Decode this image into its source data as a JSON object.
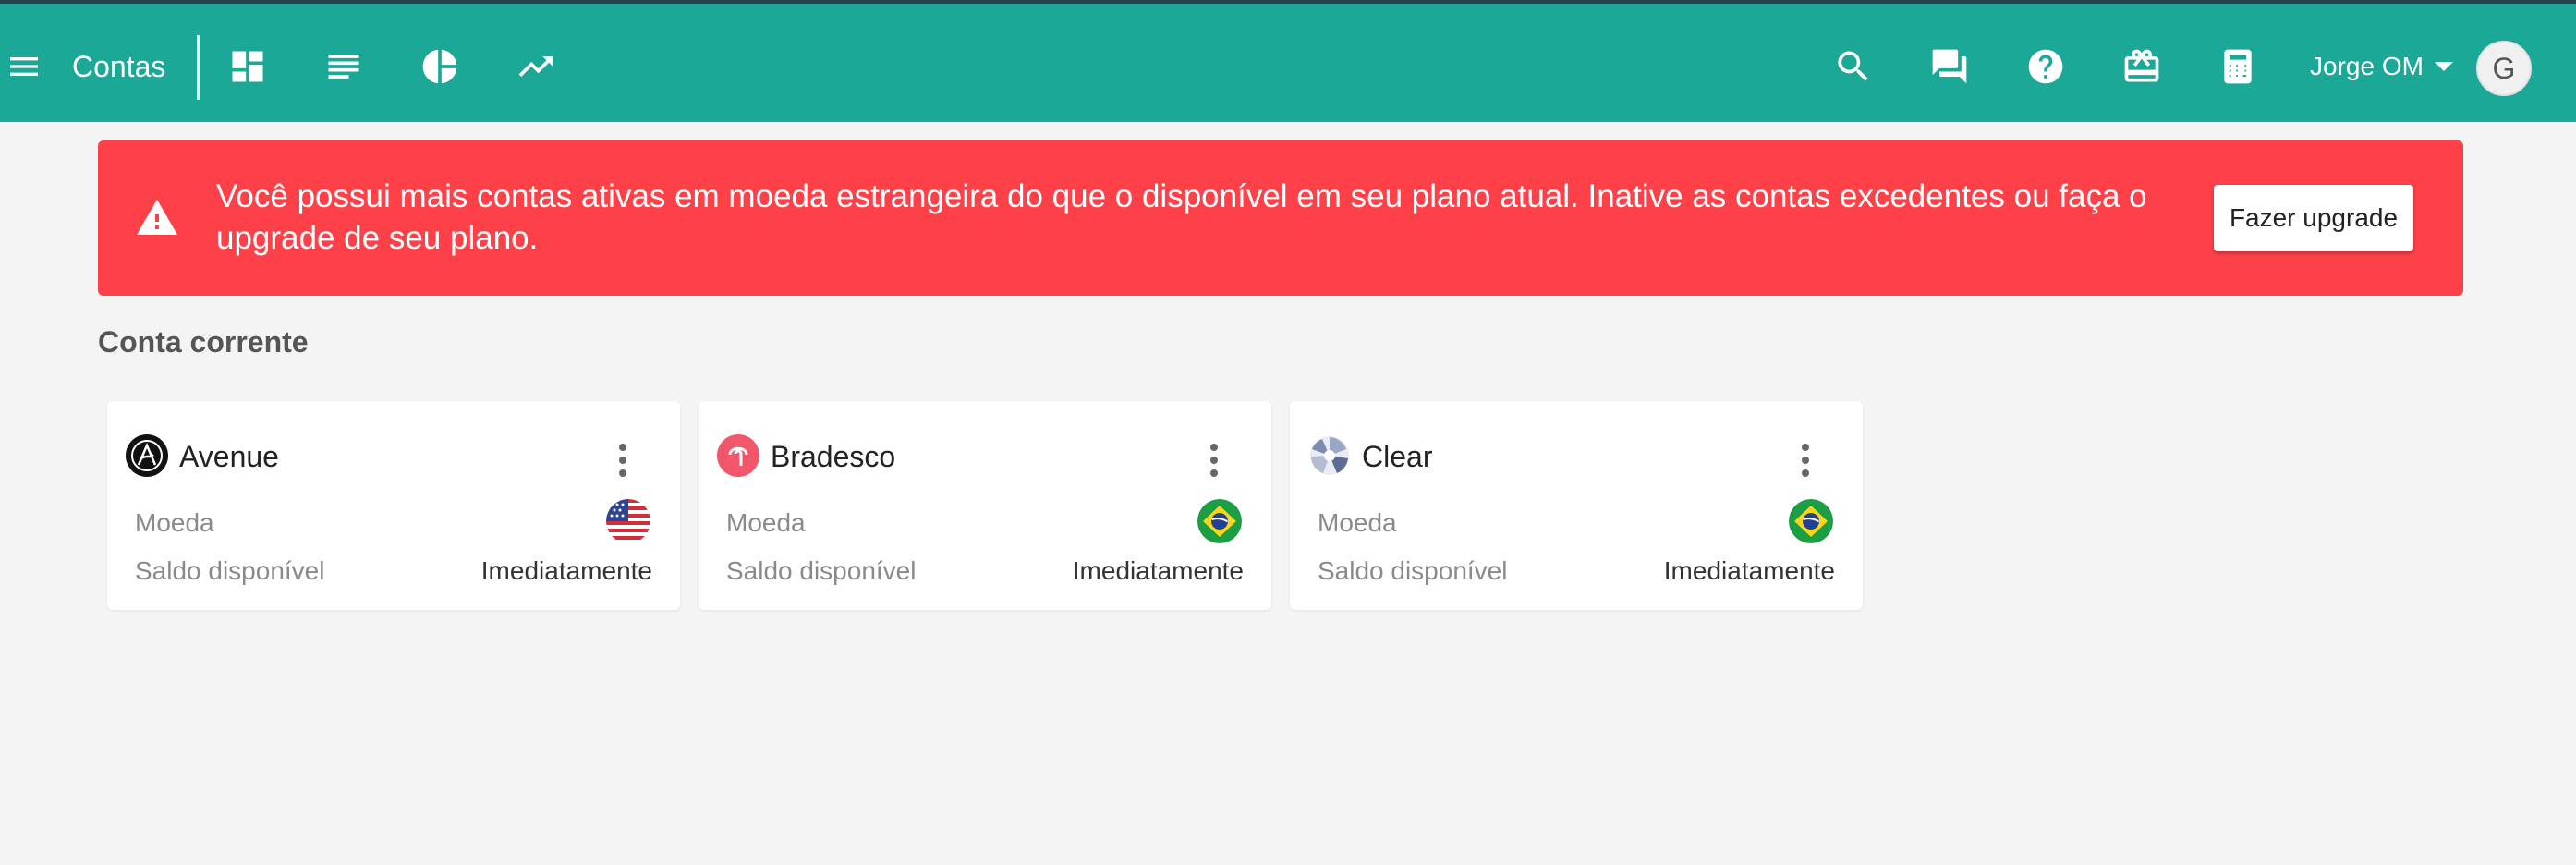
{
  "header": {
    "title": "Contas",
    "nav_icons": [
      "menu-icon",
      "dashboard-icon",
      "list-icon",
      "pie-chart-icon",
      "trending-up-icon"
    ],
    "action_icons": [
      "search-icon",
      "chat-icon",
      "help-icon",
      "gift-icon",
      "calculator-icon"
    ],
    "user": {
      "name": "Jorge OM",
      "avatar_initial": "G"
    }
  },
  "alert": {
    "message": "Você possui mais contas ativas em moeda estrangeira do que o disponível em seu plano atual. Inative as contas excedentes ou faça o upgrade de seu plano.",
    "button_label": "Fazer upgrade",
    "icon": "warning-icon"
  },
  "section": {
    "title": "Conta corrente",
    "accounts": [
      {
        "name": "Avenue",
        "logo": "avenue-logo",
        "currency_label": "Moeda",
        "currency_flag": "us-flag-icon",
        "balance_label": "Saldo disponível",
        "balance_value": "Imediatamente"
      },
      {
        "name": "Bradesco",
        "logo": "bradesco-logo",
        "currency_label": "Moeda",
        "currency_flag": "brazil-flag-icon",
        "balance_label": "Saldo disponível",
        "balance_value": "Imediatamente"
      },
      {
        "name": "Clear",
        "logo": "clear-logo",
        "currency_label": "Moeda",
        "currency_flag": "brazil-flag-icon",
        "balance_label": "Saldo disponível",
        "balance_value": "Imediatamente"
      }
    ]
  },
  "colors": {
    "topbar": "#1ba896",
    "alert": "#fe4049",
    "background": "#f4f4f4",
    "card": "#ffffff"
  }
}
